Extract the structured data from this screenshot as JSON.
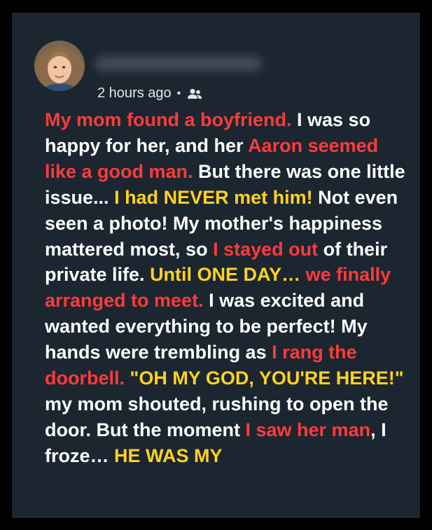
{
  "post": {
    "timestamp": "2 hours ago",
    "separator": "•",
    "audience_icon": "friends-icon",
    "segments": [
      {
        "text": "My mom found a boyfriend.",
        "color": "red"
      },
      {
        "text": " I was so happy for her, and her ",
        "color": "white"
      },
      {
        "text": "Aaron seemed like a good man.",
        "color": "red"
      },
      {
        "text": " But there was one little issue... ",
        "color": "white"
      },
      {
        "text": "I had NEVER met him!",
        "color": "yellow"
      },
      {
        "text": " Not even seen a photo! My mother's happiness mattered most, so ",
        "color": "white"
      },
      {
        "text": "I stayed out",
        "color": "red"
      },
      {
        "text": " of their private life. ",
        "color": "white"
      },
      {
        "text": "Until ONE DAY…",
        "color": "yellow"
      },
      {
        "text": " ",
        "color": "white"
      },
      {
        "text": "we finally arranged to meet.",
        "color": "red"
      },
      {
        "text": " I was excited and wanted everything to be perfect! My hands were trembling as ",
        "color": "white"
      },
      {
        "text": "I rang the doorbell.",
        "color": "red"
      },
      {
        "text": " ",
        "color": "white"
      },
      {
        "text": "\"OH MY GOD, YOU'RE HERE!\"",
        "color": "yellow"
      },
      {
        "text": " my mom shouted, rushing to open the door. But the moment ",
        "color": "white"
      },
      {
        "text": "I saw her man",
        "color": "red"
      },
      {
        "text": ", I froze… ",
        "color": "white"
      },
      {
        "text": "HE WAS MY",
        "color": "yellow"
      }
    ]
  },
  "colors": {
    "background": "#000000",
    "card": "#1c2630",
    "red": "#ff3b3b",
    "yellow": "#ffd21f",
    "white": "#ffffff",
    "meta": "#e4e6eb"
  }
}
